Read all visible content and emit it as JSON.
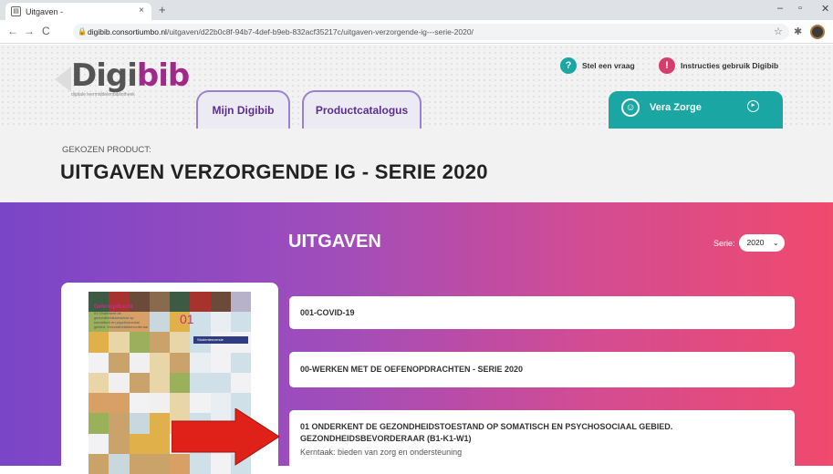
{
  "browser": {
    "tab_title": "Uitgaven -",
    "tab_close": "×",
    "new_tab": "+",
    "url_host": "digibib.consortiumbo.nl",
    "url_path": "/uitgaven/d22b0c8f-94b7-4def-b9eb-832acf35217c/uitgaven-verzorgende-ig---serie-2020/",
    "back": "←",
    "forward": "→",
    "reload": "C",
    "lock": "🔒",
    "star": "☆",
    "ext": "✱",
    "min": "–",
    "max": "▫",
    "close": "✕"
  },
  "header": {
    "logo_main": "Digi",
    "logo_accent": "bib",
    "logo_sub": "digitale leermiddelenbibliotheek",
    "tab_mijn": "Mijn Digibib",
    "tab_product": "Productcatalogus",
    "help1_icon": "?",
    "help1": "Stel een vraag",
    "help2_icon": "!",
    "help2": "Instructies gebruik Digibib",
    "user_name": "Vera Zorge",
    "colors": {
      "accent": "#1aa7a4",
      "purple": "#5b2f8d",
      "help_teal": "#1aa7a4",
      "help_pink": "#d63c6d"
    }
  },
  "product": {
    "kicker": "GEKOZEN PRODUCT:",
    "title": "UITGAVEN VERZORGENDE IG - SERIE 2020"
  },
  "main": {
    "heading": "UITGAVEN",
    "serie_label": "Serie:",
    "serie_value": "2020",
    "cover": {
      "title": "Oefenopdracht",
      "subtitle": "01 Onderkent de gezondheidstoestand op somatisch en psychosociaal gebied. Gezondheidsbevorderaar",
      "number": "01",
      "band": "Studentenversie"
    },
    "items": [
      {
        "title": "001-COVID-19"
      },
      {
        "title": "00-WERKEN MET DE OEFENOPDRACHTEN - SERIE 2020"
      },
      {
        "title": "01 ONDERKENT DE GEZONDHEIDSTOESTAND OP SOMATISCH EN PSYCHOSOCIAAL GEBIED.",
        "title2": "GEZONDHEIDSBEVORDERAAR (B1-K1-W1)",
        "sub": "Kerntaak: bieden van zorg en ondersteuning"
      }
    ],
    "arrow_color": "#e0211a"
  }
}
